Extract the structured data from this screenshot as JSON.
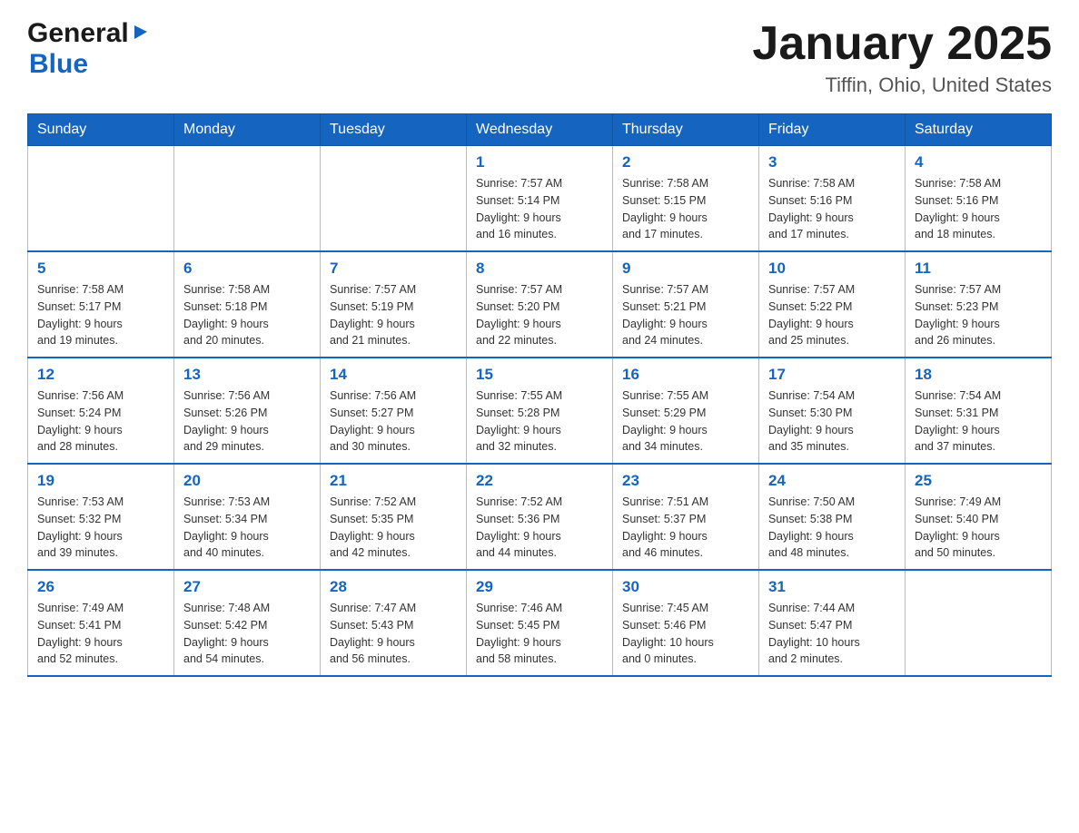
{
  "header": {
    "logo_general": "General",
    "logo_blue": "Blue",
    "month_title": "January 2025",
    "location": "Tiffin, Ohio, United States"
  },
  "days_of_week": [
    "Sunday",
    "Monday",
    "Tuesday",
    "Wednesday",
    "Thursday",
    "Friday",
    "Saturday"
  ],
  "weeks": [
    [
      {
        "day": "",
        "info": ""
      },
      {
        "day": "",
        "info": ""
      },
      {
        "day": "",
        "info": ""
      },
      {
        "day": "1",
        "info": "Sunrise: 7:57 AM\nSunset: 5:14 PM\nDaylight: 9 hours\nand 16 minutes."
      },
      {
        "day": "2",
        "info": "Sunrise: 7:58 AM\nSunset: 5:15 PM\nDaylight: 9 hours\nand 17 minutes."
      },
      {
        "day": "3",
        "info": "Sunrise: 7:58 AM\nSunset: 5:16 PM\nDaylight: 9 hours\nand 17 minutes."
      },
      {
        "day": "4",
        "info": "Sunrise: 7:58 AM\nSunset: 5:16 PM\nDaylight: 9 hours\nand 18 minutes."
      }
    ],
    [
      {
        "day": "5",
        "info": "Sunrise: 7:58 AM\nSunset: 5:17 PM\nDaylight: 9 hours\nand 19 minutes."
      },
      {
        "day": "6",
        "info": "Sunrise: 7:58 AM\nSunset: 5:18 PM\nDaylight: 9 hours\nand 20 minutes."
      },
      {
        "day": "7",
        "info": "Sunrise: 7:57 AM\nSunset: 5:19 PM\nDaylight: 9 hours\nand 21 minutes."
      },
      {
        "day": "8",
        "info": "Sunrise: 7:57 AM\nSunset: 5:20 PM\nDaylight: 9 hours\nand 22 minutes."
      },
      {
        "day": "9",
        "info": "Sunrise: 7:57 AM\nSunset: 5:21 PM\nDaylight: 9 hours\nand 24 minutes."
      },
      {
        "day": "10",
        "info": "Sunrise: 7:57 AM\nSunset: 5:22 PM\nDaylight: 9 hours\nand 25 minutes."
      },
      {
        "day": "11",
        "info": "Sunrise: 7:57 AM\nSunset: 5:23 PM\nDaylight: 9 hours\nand 26 minutes."
      }
    ],
    [
      {
        "day": "12",
        "info": "Sunrise: 7:56 AM\nSunset: 5:24 PM\nDaylight: 9 hours\nand 28 minutes."
      },
      {
        "day": "13",
        "info": "Sunrise: 7:56 AM\nSunset: 5:26 PM\nDaylight: 9 hours\nand 29 minutes."
      },
      {
        "day": "14",
        "info": "Sunrise: 7:56 AM\nSunset: 5:27 PM\nDaylight: 9 hours\nand 30 minutes."
      },
      {
        "day": "15",
        "info": "Sunrise: 7:55 AM\nSunset: 5:28 PM\nDaylight: 9 hours\nand 32 minutes."
      },
      {
        "day": "16",
        "info": "Sunrise: 7:55 AM\nSunset: 5:29 PM\nDaylight: 9 hours\nand 34 minutes."
      },
      {
        "day": "17",
        "info": "Sunrise: 7:54 AM\nSunset: 5:30 PM\nDaylight: 9 hours\nand 35 minutes."
      },
      {
        "day": "18",
        "info": "Sunrise: 7:54 AM\nSunset: 5:31 PM\nDaylight: 9 hours\nand 37 minutes."
      }
    ],
    [
      {
        "day": "19",
        "info": "Sunrise: 7:53 AM\nSunset: 5:32 PM\nDaylight: 9 hours\nand 39 minutes."
      },
      {
        "day": "20",
        "info": "Sunrise: 7:53 AM\nSunset: 5:34 PM\nDaylight: 9 hours\nand 40 minutes."
      },
      {
        "day": "21",
        "info": "Sunrise: 7:52 AM\nSunset: 5:35 PM\nDaylight: 9 hours\nand 42 minutes."
      },
      {
        "day": "22",
        "info": "Sunrise: 7:52 AM\nSunset: 5:36 PM\nDaylight: 9 hours\nand 44 minutes."
      },
      {
        "day": "23",
        "info": "Sunrise: 7:51 AM\nSunset: 5:37 PM\nDaylight: 9 hours\nand 46 minutes."
      },
      {
        "day": "24",
        "info": "Sunrise: 7:50 AM\nSunset: 5:38 PM\nDaylight: 9 hours\nand 48 minutes."
      },
      {
        "day": "25",
        "info": "Sunrise: 7:49 AM\nSunset: 5:40 PM\nDaylight: 9 hours\nand 50 minutes."
      }
    ],
    [
      {
        "day": "26",
        "info": "Sunrise: 7:49 AM\nSunset: 5:41 PM\nDaylight: 9 hours\nand 52 minutes."
      },
      {
        "day": "27",
        "info": "Sunrise: 7:48 AM\nSunset: 5:42 PM\nDaylight: 9 hours\nand 54 minutes."
      },
      {
        "day": "28",
        "info": "Sunrise: 7:47 AM\nSunset: 5:43 PM\nDaylight: 9 hours\nand 56 minutes."
      },
      {
        "day": "29",
        "info": "Sunrise: 7:46 AM\nSunset: 5:45 PM\nDaylight: 9 hours\nand 58 minutes."
      },
      {
        "day": "30",
        "info": "Sunrise: 7:45 AM\nSunset: 5:46 PM\nDaylight: 10 hours\nand 0 minutes."
      },
      {
        "day": "31",
        "info": "Sunrise: 7:44 AM\nSunset: 5:47 PM\nDaylight: 10 hours\nand 2 minutes."
      },
      {
        "day": "",
        "info": ""
      }
    ]
  ]
}
